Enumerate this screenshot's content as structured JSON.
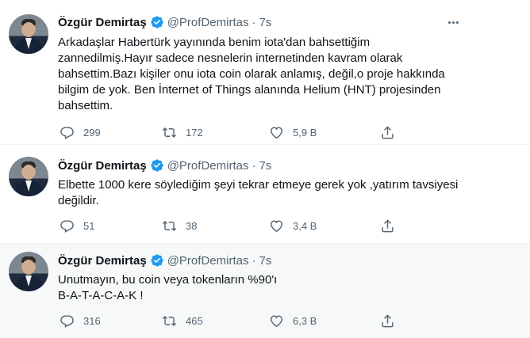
{
  "tweets": [
    {
      "author_name": "Özgür Demirtaş",
      "handle": "@ProfDemirtas",
      "separator": "·",
      "time": "7s",
      "lines": [
        "Arkadaşlar Habertürk yayınında benim iota'dan bahsettiğim",
        "zannedilmiş.Hayır sadece nesnelerin internetinden kavram olarak",
        "bahsettim.Bazı kişiler onu iota coin olarak anlamış, değil,o proje hakkında",
        "bilgim de yok. Ben İnternet of Things alanında Helium (HNT) projesinden",
        "bahsettim."
      ],
      "replies": "299",
      "retweets": "172",
      "likes": "5,9 B"
    },
    {
      "author_name": "Özgür Demirtaş",
      "handle": "@ProfDemirtas",
      "separator": "·",
      "time": "7s",
      "lines": [
        "Elbette 1000 kere söylediğim şeyi tekrar etmeye gerek yok ,yatırım tavsiyesi",
        "değildir."
      ],
      "replies": "51",
      "retweets": "38",
      "likes": "3,4 B"
    },
    {
      "author_name": "Özgür Demirtaş",
      "handle": "@ProfDemirtas",
      "separator": "·",
      "time": "7s",
      "lines": [
        "Unutmayın, bu coin veya tokenların %90'ı",
        "B-A-T-A-C-A-K !"
      ],
      "replies": "316",
      "retweets": "465",
      "likes": "6,3 B"
    }
  ],
  "icons": {
    "verified": "verified-badge-icon",
    "reply": "reply-icon",
    "retweet": "retweet-icon",
    "like": "heart-icon",
    "share": "share-icon",
    "more": "more-icon"
  },
  "colors": {
    "verified": "#1d9bf0",
    "secondary_text": "#536471",
    "primary_text": "#0f1419",
    "highlight_bg": "#f7f9f9"
  }
}
